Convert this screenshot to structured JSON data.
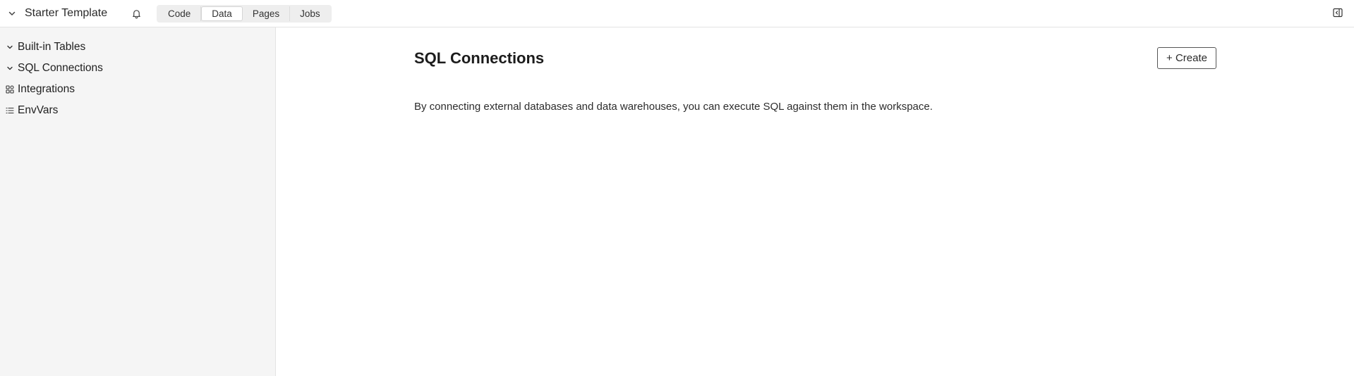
{
  "header": {
    "workspace_name": "Starter Template",
    "workspace_switch_icon": "chevron-down-icon",
    "notification_icon": "bell-icon",
    "tabs": [
      {
        "label": "Code",
        "active": false
      },
      {
        "label": "Data",
        "active": true
      },
      {
        "label": "Pages",
        "active": false
      },
      {
        "label": "Jobs",
        "active": false
      }
    ],
    "panel_toggle_icon": "sidebar-toggle-icon"
  },
  "sidebar": {
    "items": [
      {
        "label": "Built-in Tables",
        "icon": "chevron-down-icon"
      },
      {
        "label": "SQL Connections",
        "icon": "chevron-down-icon"
      },
      {
        "label": "Integrations",
        "icon": "integrations-icon"
      },
      {
        "label": "EnvVars",
        "icon": "list-icon"
      }
    ]
  },
  "main": {
    "title": "SQL Connections",
    "create_label": "+ Create",
    "description": "By connecting external databases and data warehouses, you can execute SQL against them in the workspace."
  },
  "colors": {
    "sidebar_bg": "#f5f5f5",
    "tab_group_bg": "#eeeeee",
    "border": "#e3e3e3",
    "text": "#1f1f1f"
  }
}
